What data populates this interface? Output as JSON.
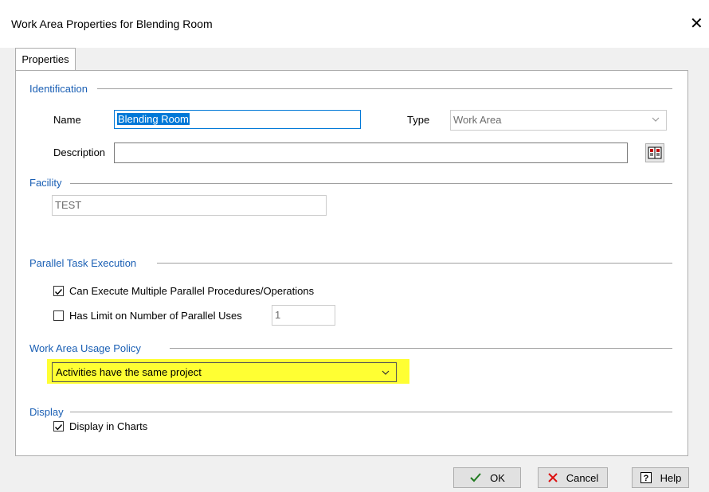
{
  "window": {
    "title": "Work Area Properties for Blending Room",
    "close_glyph": "✕"
  },
  "tabs": [
    {
      "label": "Properties"
    }
  ],
  "identification": {
    "section_title": "Identification",
    "name_label": "Name",
    "name_value": "Blending Room",
    "type_label": "Type",
    "type_value": "Work Area",
    "description_label": "Description",
    "description_value": ""
  },
  "facility": {
    "section_title": "Facility",
    "value": "TEST"
  },
  "parallel": {
    "section_title": "Parallel Task Execution",
    "multi_label": "Can Execute Multiple Parallel Procedures/Operations",
    "multi_checked": true,
    "limit_label": "Has Limit on Number of Parallel Uses",
    "limit_checked": false,
    "limit_value": "1"
  },
  "usage": {
    "section_title": "Work Area Usage Policy",
    "selected": "Activities have the same project",
    "highlight_color": "#ffff33"
  },
  "display": {
    "section_title": "Display",
    "charts_label": "Display in Charts",
    "charts_checked": true
  },
  "buttons": {
    "ok_label": "OK",
    "cancel_label": "Cancel",
    "help_label": "Help"
  },
  "colors": {
    "section_title": "#1a5fb4",
    "selection": "#0078d7"
  }
}
